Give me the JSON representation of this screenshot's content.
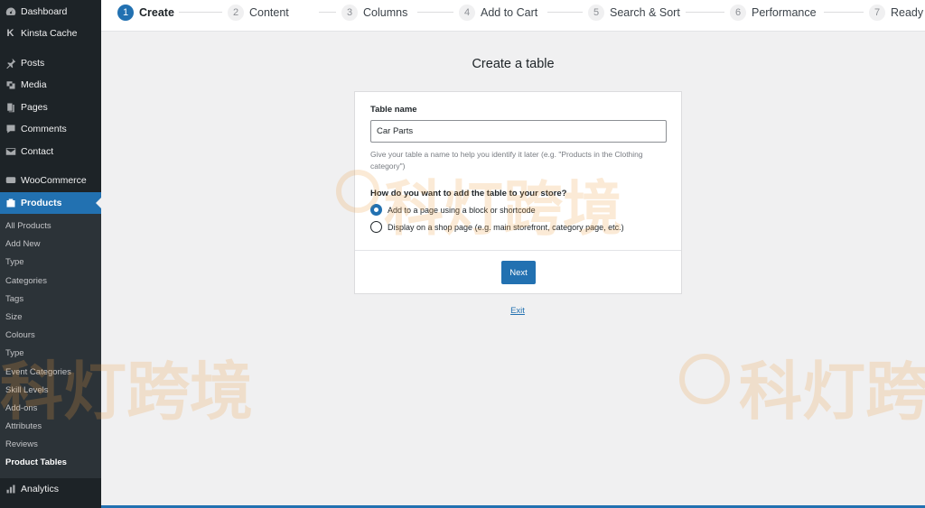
{
  "sidebar": {
    "top_items": [
      {
        "label": "Dashboard",
        "icon": "dashboard-icon"
      },
      {
        "label": "Kinsta Cache",
        "icon": "kinsta-icon"
      }
    ],
    "content_items": [
      {
        "label": "Posts",
        "icon": "pin-icon"
      },
      {
        "label": "Media",
        "icon": "media-icon"
      },
      {
        "label": "Pages",
        "icon": "pages-icon"
      },
      {
        "label": "Comments",
        "icon": "comments-icon"
      },
      {
        "label": "Contact",
        "icon": "mail-icon"
      }
    ],
    "woocommerce": {
      "label": "WooCommerce",
      "icon": "woocommerce-icon"
    },
    "products": {
      "label": "Products",
      "icon": "products-icon"
    },
    "submenu": [
      "All Products",
      "Add New",
      "Type",
      "Categories",
      "Tags",
      "Size",
      "Colours",
      "Type",
      "Event Categories",
      "Skill Levels",
      "Add-ons",
      "Attributes",
      "Reviews",
      "Product Tables"
    ],
    "current_submenu": "Product Tables",
    "analytics": {
      "label": "Analytics",
      "icon": "analytics-icon"
    }
  },
  "steps": [
    {
      "num": "1",
      "label": "Create"
    },
    {
      "num": "2",
      "label": "Content"
    },
    {
      "num": "3",
      "label": "Columns"
    },
    {
      "num": "4",
      "label": "Add to Cart"
    },
    {
      "num": "5",
      "label": "Search & Sort"
    },
    {
      "num": "6",
      "label": "Performance"
    },
    {
      "num": "7",
      "label": "Ready"
    }
  ],
  "active_step": 1,
  "main": {
    "title": "Create a table",
    "table_name_label": "Table name",
    "table_name_value": "Car Parts",
    "help_text": "Give your table a name to help you identify it later (e.g. \"Products in the Clothing category\")",
    "question": "How do you want to add the table to your store?",
    "options": [
      {
        "label": "Add to a page using a block or shortcode",
        "checked": true
      },
      {
        "label": "Display on a shop page (e.g. main storefront, category page, etc.)",
        "checked": false
      }
    ],
    "next_label": "Next",
    "exit_label": "Exit"
  },
  "watermark": "科灯跨境",
  "colors": {
    "accent": "#2271b1",
    "sidebar_bg": "#1d2327",
    "submenu_bg": "#2c3338",
    "page_bg": "#f0f0f1"
  }
}
